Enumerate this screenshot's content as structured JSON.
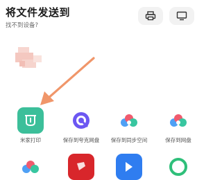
{
  "header": {
    "title": "将文件发送到",
    "subtitle": "找不到设备?"
  },
  "toolbar": {
    "print_icon": "printer-icon",
    "screen_icon": "monitor-icon"
  },
  "colors": {
    "accent_arrow": "#f0966a",
    "mijia_green": "#3cbf9a"
  },
  "apps_row1": [
    {
      "label": "米家打印",
      "icon": "mijia-icon"
    },
    {
      "label": "保存到夸克网盘",
      "icon": "quark-icon"
    },
    {
      "label": "保存到同步空间",
      "icon": "cloud-sync-icon"
    },
    {
      "label": "保存到网盘",
      "icon": "cloud-drive-icon"
    }
  ]
}
